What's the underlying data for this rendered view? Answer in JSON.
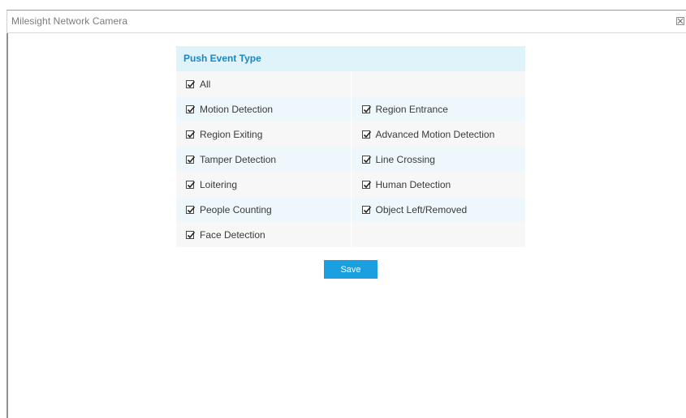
{
  "window": {
    "title": "Milesight Network Camera",
    "close_symbol": "✕"
  },
  "panel": {
    "header": "Push Event Type",
    "rows": [
      {
        "left": {
          "label": "All",
          "checked": true
        },
        "right": null
      },
      {
        "left": {
          "label": "Motion Detection",
          "checked": true
        },
        "right": {
          "label": "Region Entrance",
          "checked": true
        }
      },
      {
        "left": {
          "label": "Region Exiting",
          "checked": true
        },
        "right": {
          "label": "Advanced Motion Detection",
          "checked": true
        }
      },
      {
        "left": {
          "label": "Tamper Detection",
          "checked": true
        },
        "right": {
          "label": "Line Crossing",
          "checked": true
        }
      },
      {
        "left": {
          "label": "Loitering",
          "checked": true
        },
        "right": {
          "label": "Human Detection",
          "checked": true
        }
      },
      {
        "left": {
          "label": "People Counting",
          "checked": true
        },
        "right": {
          "label": "Object Left/Removed",
          "checked": true
        }
      },
      {
        "left": {
          "label": "Face Detection",
          "checked": true
        },
        "right": null
      }
    ]
  },
  "actions": {
    "save_label": "Save"
  },
  "colors": {
    "header_bg": "#dff3fb",
    "header_text": "#1b85c6",
    "row_alt_bg": "#eef8fc",
    "row_plain_bg": "#f7f7f7",
    "save_bg": "#1a9fe0"
  },
  "icons": {
    "close": "close-icon",
    "checkbox": "checkmark-icon"
  }
}
